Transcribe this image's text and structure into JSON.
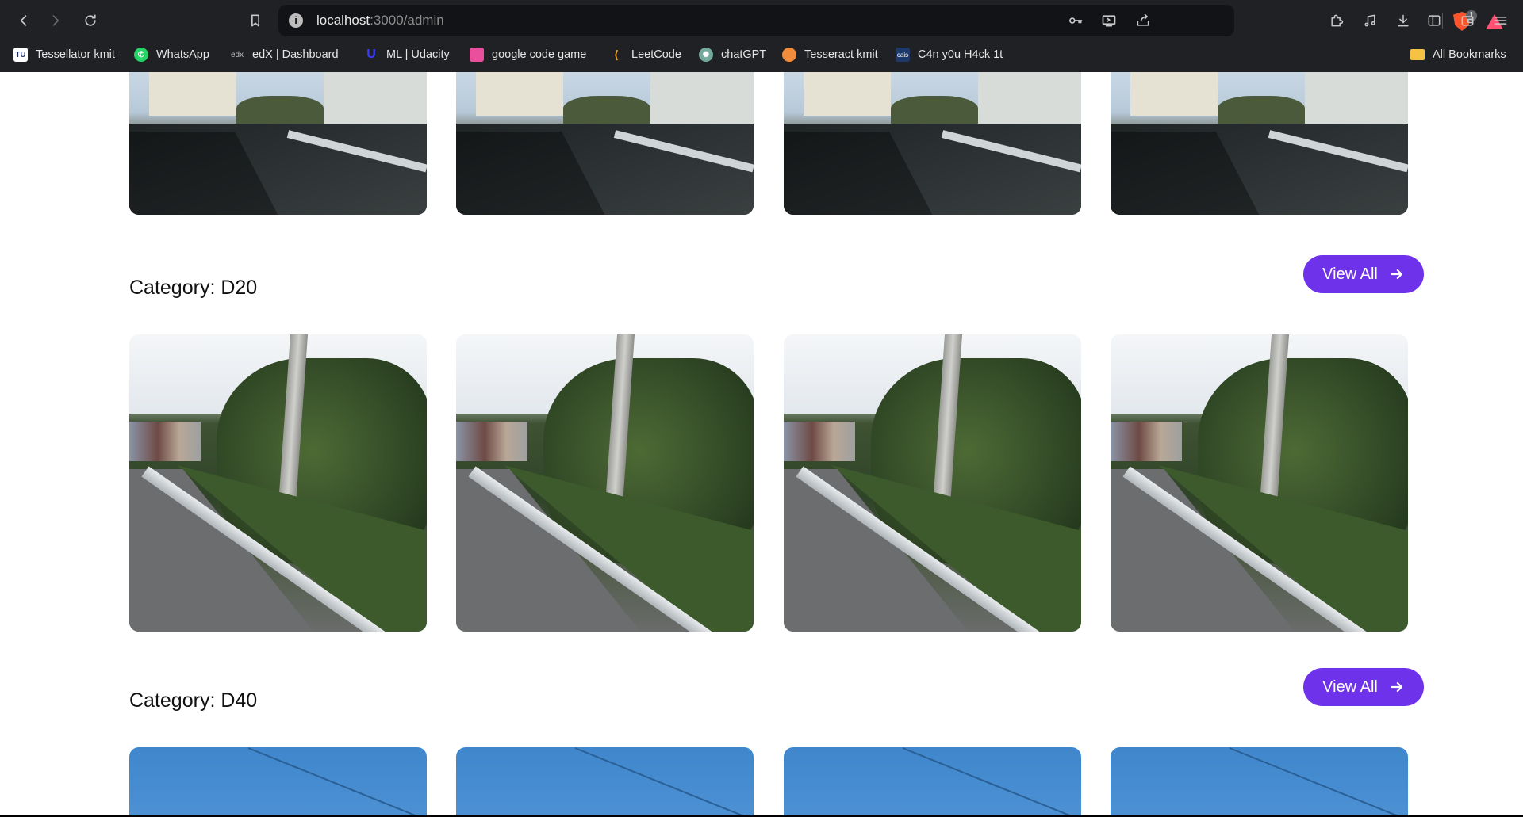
{
  "browser": {
    "url_host": "localhost",
    "url_path": ":3000/admin",
    "brave_badge_count": "1",
    "bookmarks": [
      {
        "label": "Tessellator kmit",
        "icon": "tu-logo-icon",
        "color": "#ffffff"
      },
      {
        "label": "WhatsApp",
        "icon": "whatsapp-icon",
        "color": "#25d366"
      },
      {
        "label": "edX | Dashboard",
        "icon": "edx-icon",
        "color": "#202124"
      },
      {
        "label": "ML | Udacity",
        "icon": "udacity-icon",
        "color": "#2015ff"
      },
      {
        "label": "google code game",
        "icon": "code-game-icon",
        "color": "#e94f9c"
      },
      {
        "label": "LeetCode",
        "icon": "leetcode-icon",
        "color": "#ffa116"
      },
      {
        "label": "chatGPT",
        "icon": "chatgpt-icon",
        "color": "#74aa9c"
      },
      {
        "label": "Tesseract kmit",
        "icon": "tesseract-icon",
        "color": "#f08c3c"
      },
      {
        "label": "C4n y0u H4ck 1t",
        "icon": "cais-icon",
        "color": "#1d3a6b"
      },
      {
        "label": "All Bookmarks",
        "icon": "folder-icon",
        "color": "#f6c244"
      }
    ]
  },
  "page": {
    "categories": [
      {
        "title": "Category: D20",
        "view_all_label": "View All"
      },
      {
        "title": "Category: D40",
        "view_all_label": "View All"
      }
    ]
  },
  "colors": {
    "accent": "#6d32ea",
    "chrome_bg": "#202124",
    "page_bg": "#ffffff"
  }
}
